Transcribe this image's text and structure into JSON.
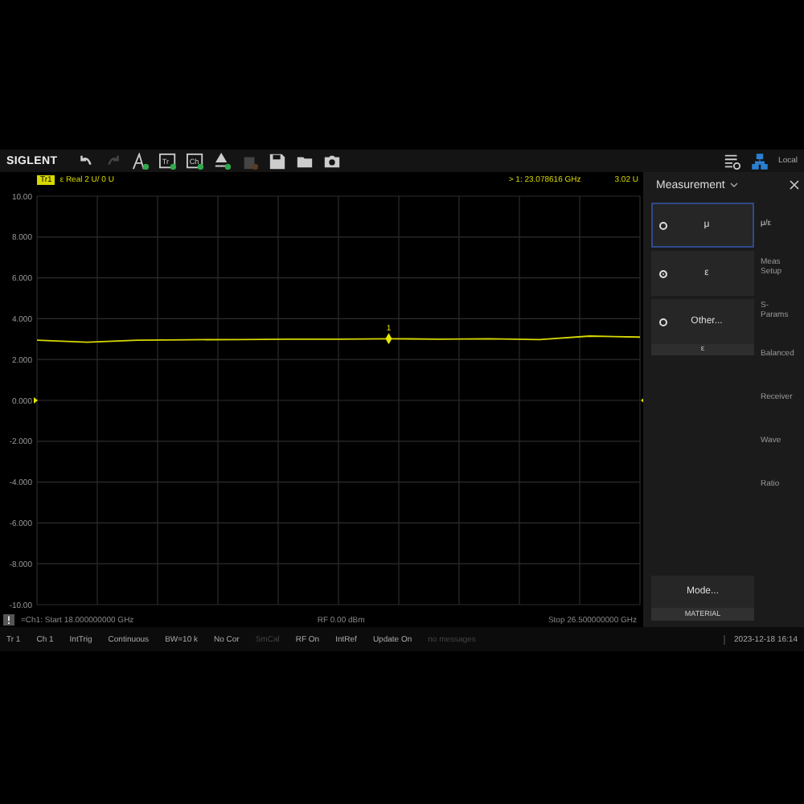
{
  "toolbar": {
    "logo": "SIGLENT",
    "tools": [
      {
        "kind": "undo",
        "disabled": false
      },
      {
        "kind": "redo",
        "disabled": true
      },
      {
        "kind": "trace",
        "disabled": false
      },
      {
        "kind": "box",
        "text": "Tr",
        "disabled": false
      },
      {
        "kind": "box",
        "text": "Ch",
        "disabled": false
      },
      {
        "kind": "marker",
        "disabled": false
      },
      {
        "kind": "calibration",
        "disabled": true
      },
      {
        "kind": "save",
        "disabled": false
      },
      {
        "kind": "open",
        "disabled": false
      },
      {
        "kind": "camera",
        "disabled": false
      }
    ],
    "local_label": "Local"
  },
  "plot": {
    "trace_badge": "Tr1",
    "trace_label": "ε Real 2 U/ 0 U",
    "marker_readout": "> 1: 23.078616 GHz",
    "marker_value": "3.02 U",
    "chart_data": {
      "type": "line",
      "ylim": [
        -10,
        10
      ],
      "categories": [
        null,
        null,
        null,
        null,
        null,
        null,
        null,
        null,
        null,
        null,
        null,
        null,
        null
      ],
      "series": [
        {
          "color": "#d8d800",
          "values": [
            2.95,
            2.85,
            2.95,
            2.97,
            2.98,
            3.0,
            3.0,
            3.02,
            3.0,
            3.02,
            2.98,
            3.15,
            3.1
          ]
        }
      ],
      "yticks": [
        {
          "value": 10,
          "label": "10.00"
        },
        {
          "value": 8,
          "label": "8.000"
        },
        {
          "value": 6,
          "label": "6.000"
        },
        {
          "value": 4,
          "label": "4.000"
        },
        {
          "value": 2,
          "label": "2.000"
        },
        {
          "value": 0,
          "label": "0.000"
        },
        {
          "value": -2,
          "label": "-2.000"
        },
        {
          "value": -4,
          "label": "-4.000"
        },
        {
          "value": -6,
          "label": "-6.000"
        },
        {
          "value": -8,
          "label": "-8.000"
        },
        {
          "value": -10,
          "label": "-10.00"
        }
      ],
      "grid": true,
      "annotations": [
        {
          "y": 3.02,
          "text": "1"
        }
      ]
    },
    "start": "=Ch1: Start 18.000000000 GHz",
    "power": "RF 0.00 dBm",
    "stop": "Stop 26.500000000 GHz"
  },
  "panel": {
    "title": "Measurement",
    "options": [
      {
        "label": "μ",
        "selected": false,
        "focused": true
      },
      {
        "label": "ε",
        "selected": true,
        "focused": false
      },
      {
        "label": "Other...",
        "selected": false,
        "focused": false,
        "sub": "ε"
      }
    ],
    "softkeys": [
      "μ/ε",
      "Meas Setup",
      "S-Params",
      "Balanced",
      "Receiver",
      "Wave",
      "Ratio"
    ],
    "mode": {
      "label": "Mode...",
      "value": "MATERIAL"
    }
  },
  "status_bar": {
    "items": [
      {
        "text": "Tr 1",
        "disabled": false
      },
      {
        "text": "Ch 1",
        "disabled": false
      },
      {
        "text": "IntTrig",
        "disabled": false
      },
      {
        "text": "Continuous",
        "disabled": false
      },
      {
        "text": "BW=10 k",
        "disabled": false
      },
      {
        "text": "No Cor",
        "disabled": false
      },
      {
        "text": "SmCal",
        "disabled": true
      },
      {
        "text": "RF On",
        "disabled": false
      },
      {
        "text": "IntRef",
        "disabled": false
      },
      {
        "text": "Update On",
        "disabled": false
      },
      {
        "text": "no messages",
        "disabled": true
      }
    ],
    "datetime": "2023-12-18 16:14"
  }
}
